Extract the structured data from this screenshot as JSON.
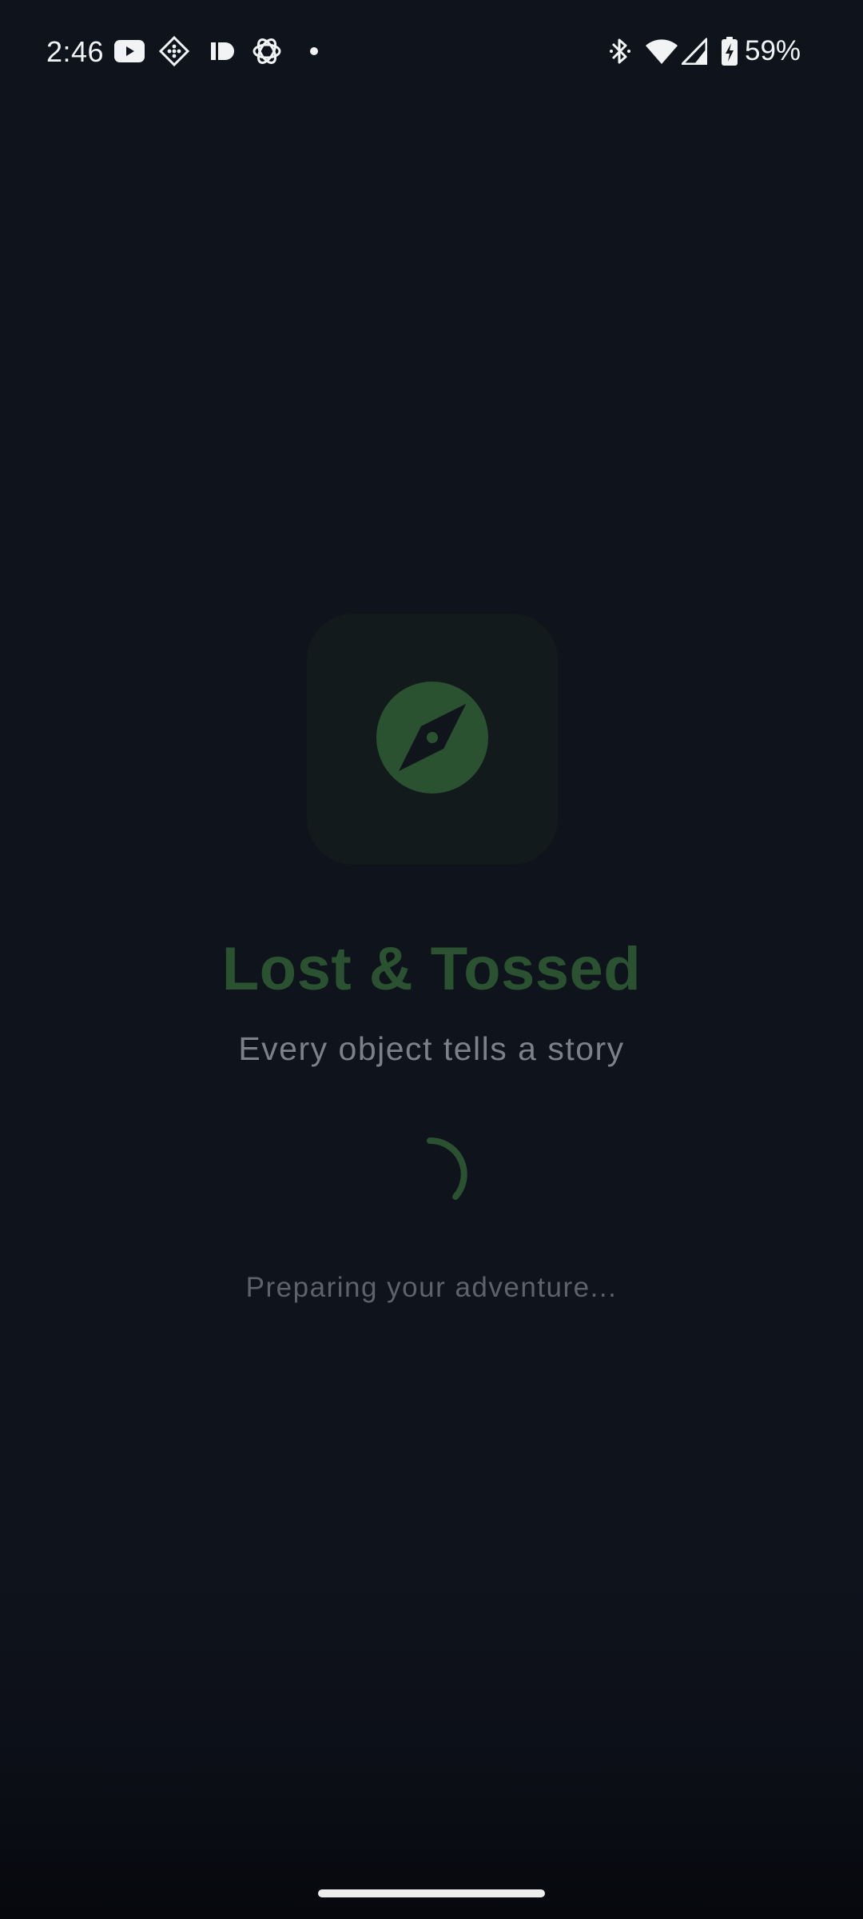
{
  "status_bar": {
    "time": "2:46",
    "battery_percent": "59%",
    "notification_icons": [
      "youtube-icon",
      "diamond-grid-icon",
      "id-icon",
      "openai-icon",
      "dot-icon"
    ],
    "system_icons": [
      "bluetooth-icon",
      "wifi-icon",
      "signal-icon",
      "battery-charging-icon"
    ]
  },
  "splash": {
    "app_icon": "compass-icon",
    "title": "Lost & Tossed",
    "tagline": "Every object tells a story",
    "loading_text": "Preparing your adventure..."
  },
  "colors": {
    "background": "#0f131c",
    "accent_green": "#2a5230",
    "icon_tile": "#121a1c",
    "status_text": "#f2f3f5"
  }
}
